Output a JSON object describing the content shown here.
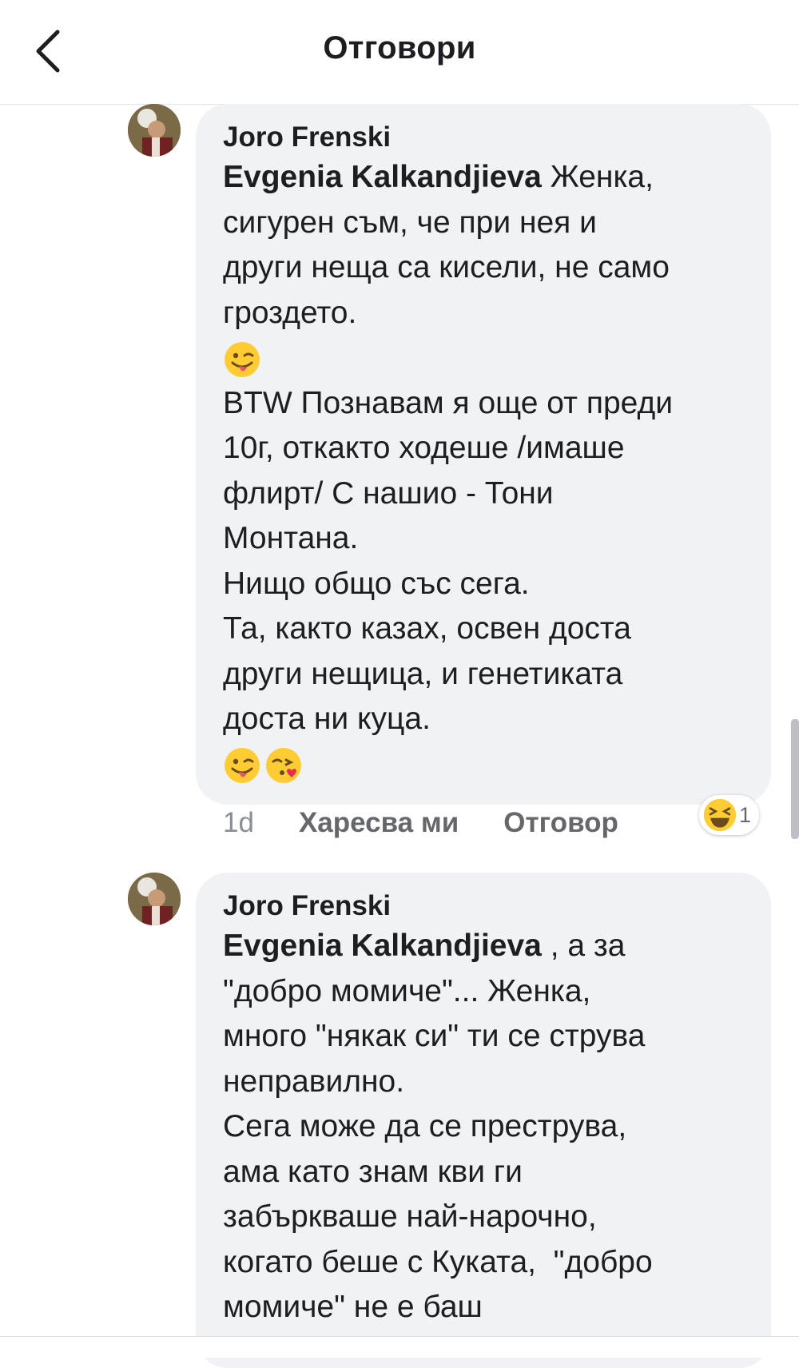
{
  "header": {
    "title": "Отговори",
    "back_icon": "chevron-left-icon"
  },
  "comments": [
    {
      "author": "Joro Frenski",
      "mention": "Evgenia Kalkandjieva",
      "text_after_mention": " Женка,\nсигурен съм, че при нея и\nдруги неща са кисели, не само\nгроздето.",
      "emoji_line_1": [
        "winking-face-with-tongue"
      ],
      "text_2": "BTW Познавам я още от преди\n10г, откакто ходеше /имаше\nфлирт/ С нашио - Тони\nМонтана.\nНищо общо със сега.\nТа, както казах, освен доста\nдруги нещица, и генетиката\nдоста ни куца.",
      "emoji_line_2": [
        "winking-face-with-tongue",
        "face-blowing-kiss"
      ],
      "time": "1d",
      "like_label": "Харесва ми",
      "reply_label": "Отговор",
      "reaction_icon": "laughing-face",
      "reaction_count": "1"
    },
    {
      "author": "Joro Frenski",
      "mention": "Evgenia Kalkandjieva",
      "text_after_mention": " , а за\n\"добро момиче\"... Женка,\nмного \"някак си\" ти се струва\nнеправилно.\nСега може да се преструва,\nама като знам кви ги\nзабъркваше най-нарочно,\nкогато беше с Куката,  \"добро\nмомиче\" не е баш"
    }
  ],
  "colors": {
    "bubble": "#f0f2f5",
    "text": "#1c1e21",
    "secondary": "#65676b",
    "emoji_yellow": "#ffcc33"
  }
}
